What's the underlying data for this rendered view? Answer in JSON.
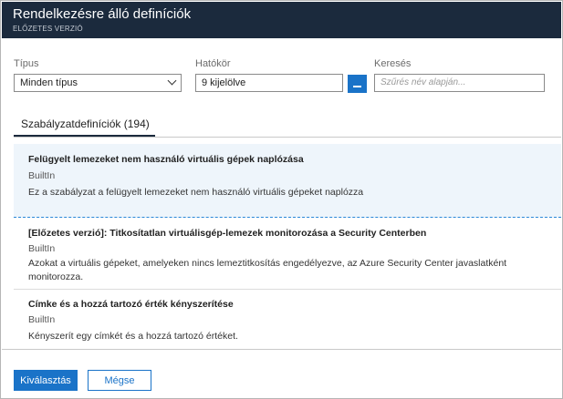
{
  "window": {
    "title": "Rendelkezésre álló definíciók",
    "subtitle": "ELŐZETES VERZIÓ"
  },
  "filters": {
    "type_label": "Típus",
    "type_value": "Minden típus",
    "scope_label": "Hatókör",
    "scope_value": "9 kijelölve",
    "scope_button_label": "...",
    "search_label": "Keresés",
    "search_placeholder": "Szűrés név alapján..."
  },
  "tabs": [
    {
      "label": "Szabályzatdefiníciók (194)"
    }
  ],
  "definitions": [
    {
      "title": "Felügyelt lemezeket nem használó virtuális gépek naplózása",
      "type": "BuiltIn",
      "description": "Ez a szabályzat a felügyelt lemezeket nem használó virtuális gépeket naplózza"
    },
    {
      "title": "[Előzetes verzió]: Titkosítatlan virtuálisgép-lemezek monitorozása a Security Centerben",
      "type": "BuiltIn",
      "description": "Azokat a virtuális gépeket, amelyeken nincs lemeztitkosítás engedélyezve, az Azure Security Center javaslatként monitorozza."
    },
    {
      "title": "Címke és a hozzá tartozó érték kényszerítése",
      "type": "BuiltIn",
      "description": "Kényszerít egy címkét és a hozzá tartozó értéket."
    }
  ],
  "footer": {
    "select_label": "Kiválasztás",
    "cancel_label": "Mégse"
  },
  "colors": {
    "titlebar": "#1b2a3d",
    "accent": "#1a73c8",
    "selected_row": "#eef5fb"
  }
}
